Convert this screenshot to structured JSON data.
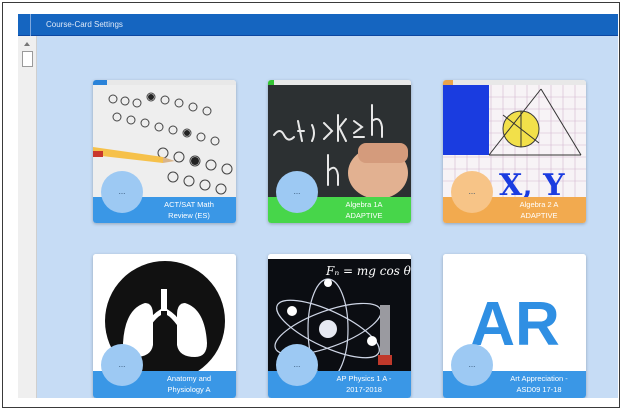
{
  "window": {
    "title": "Course-Card Settings"
  },
  "cards": [
    {
      "label_line1": "ACT/SAT Math",
      "label_line2": "Review (ES)",
      "avatar_text": "...",
      "footer_color": "#3a97e6",
      "stripe_color": "#2a83d9",
      "image": "exam-answer-sheet-image"
    },
    {
      "label_line1": "Algebra 1A",
      "label_line2": "ADAPTIVE",
      "avatar_text": "...",
      "footer_color": "#47d64a",
      "stripe_color": "#34c434",
      "image": "chalkboard-inequality-image"
    },
    {
      "label_line1": "Algebra 2 A",
      "label_line2": "ADAPTIVE",
      "avatar_text": "...",
      "footer_color": "#f2aa4f",
      "stripe_color": "#eba44a",
      "image": "geometry-graph-image"
    },
    {
      "label_line1": "Anatomy and",
      "label_line2": "Physiology A",
      "avatar_text": "...",
      "footer_color": "#3a97e6",
      "stripe_color": "#3a97e6",
      "image": "lungs-icon-image"
    },
    {
      "label_line1": "AP Physics 1 A -",
      "label_line2": "2017-2018",
      "avatar_text": "...",
      "footer_color": "#3a97e6",
      "stripe_color": "#3a97e6",
      "image": "atom-orbit-image"
    },
    {
      "label_line1": "Art Appreciation -",
      "label_line2": "ASD09 17-18",
      "avatar_text": "...",
      "footer_color": "#3a97e6",
      "stripe_color": "#3a97e6",
      "image": "ar-letters-image"
    }
  ],
  "images": {
    "physics_formula": "Fₙ = mg cos θ",
    "art_letters": "AR",
    "algebra_letters": "X, Y"
  }
}
